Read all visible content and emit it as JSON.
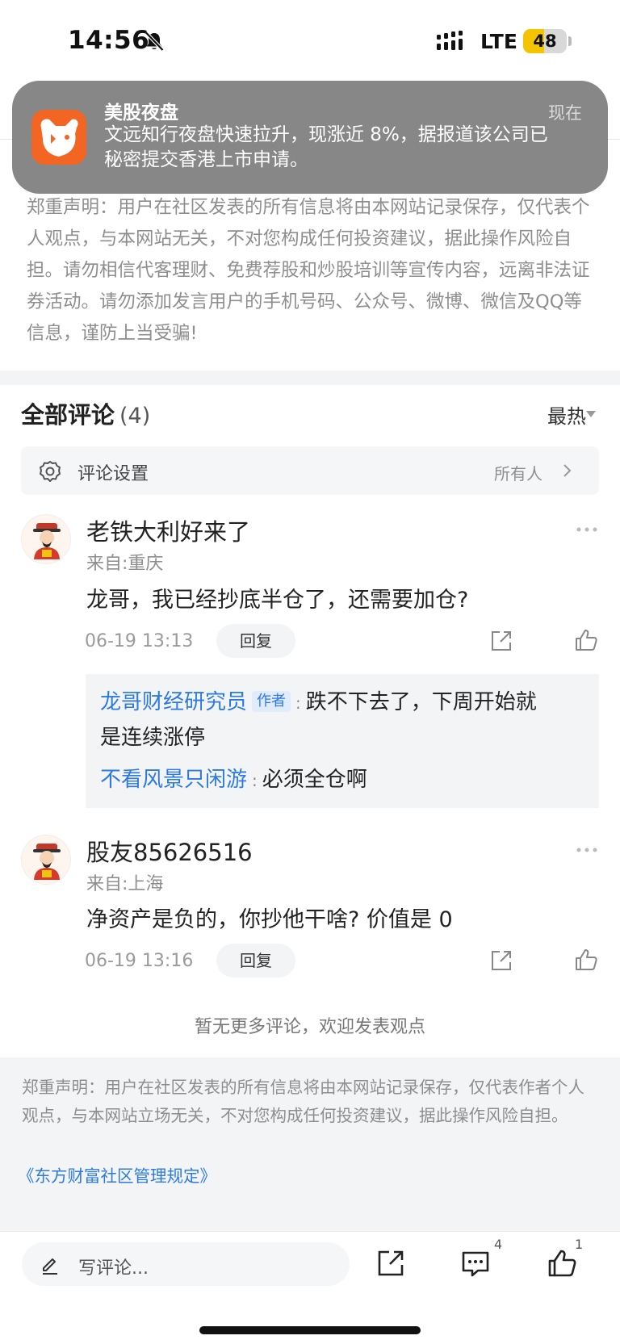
{
  "status_bar": {
    "time": "14:56",
    "network": "LTE",
    "battery": "48",
    "battery_level": 0.48
  },
  "notification": {
    "app_name": "美股夜盘",
    "time": "现在",
    "message": "文远知行夜盘快速拉升，现涨近 8%，据报道该公司已秘密提交香港上市申请。"
  },
  "disclaimer_top": "郑重声明：用户在社区发表的所有信息将由本网站记录保存，仅代表个人观点，与本网站无关，不对您构成任何投资建议，据此操作风险自担。请勿相信代客理财、免费荐股和炒股培训等宣传内容，远离非法证券活动。请勿添加发言用户的手机号码、公众号、微博、微信及QQ等信息，谨防上当受骗!",
  "comments_header": {
    "title": "全部评论",
    "count": "(4)",
    "sort": "最热"
  },
  "comment_settings": {
    "label": "评论设置",
    "value": "所有人"
  },
  "comments": [
    {
      "username": "老铁大利好来了",
      "location": "来自:重庆",
      "text": "龙哥，我已经抄底半仓了，还需要加仓?",
      "date": "06-19 13:13",
      "reply_label": "回复",
      "replies": [
        {
          "author": "龙哥财经研究员",
          "tag": "作者",
          "text_line1": "跌不下去了，下周开始就",
          "text_line2": "是连续涨停"
        },
        {
          "author": "不看风景只闲游",
          "text": "必须全仓啊"
        }
      ]
    },
    {
      "username": "股友85626516",
      "location": "来自:上海",
      "text": "净资产是负的，你抄他干啥? 价值是 0",
      "date": "06-19 13:16",
      "reply_label": "回复"
    }
  ],
  "no_more": "暂无更多评论，欢迎发表观点",
  "disclaimer_bottom": {
    "text": "郑重声明：用户在社区发表的所有信息将由本网站记录保存，仅代表作者个人观点，与本网站立场无关，不对您构成任何投资建议，据此操作风险自担。",
    "link": "《东方财富社区管理规定》"
  },
  "bottom_bar": {
    "placeholder": "写评论...",
    "comment_count": "4",
    "like_count": "1"
  },
  "colors": {
    "link_blue": "#2d7ae4",
    "app_icon_orange": "#f26522",
    "battery_yellow": "#f5c400"
  }
}
